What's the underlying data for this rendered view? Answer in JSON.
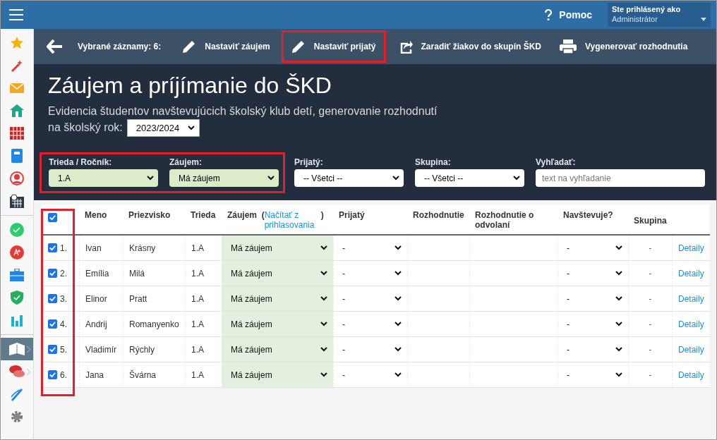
{
  "top_bar": {
    "help": "Pomoc",
    "user_label": "Ste prihlásený ako",
    "user_role": "Administrátor"
  },
  "sidebar": {
    "items": [
      {
        "kind": "star",
        "selected": false,
        "expandable": false
      },
      {
        "kind": "wand",
        "selected": false,
        "expandable": false
      },
      {
        "kind": "mail",
        "selected": false,
        "expandable": false
      },
      {
        "kind": "home",
        "selected": false,
        "expandable": false
      },
      {
        "kind": "calendar",
        "selected": false,
        "expandable": false
      },
      {
        "kind": "notebook",
        "selected": false,
        "expandable": false
      },
      {
        "kind": "person",
        "selected": false,
        "expandable": false
      },
      {
        "kind": "schedule",
        "selected": false,
        "expandable": false
      },
      {
        "kind": "divider"
      },
      {
        "kind": "check",
        "selected": false,
        "expandable": false
      },
      {
        "kind": "grade",
        "selected": false,
        "expandable": false
      },
      {
        "kind": "briefcase",
        "selected": false,
        "expandable": false
      },
      {
        "kind": "shield",
        "selected": false,
        "expandable": false
      },
      {
        "kind": "chart",
        "selected": false,
        "expandable": false
      },
      {
        "kind": "divider"
      },
      {
        "kind": "book",
        "selected": true,
        "expandable": true
      },
      {
        "kind": "chat",
        "selected": false,
        "expandable": true
      },
      {
        "kind": "pen",
        "selected": false,
        "expandable": false
      },
      {
        "kind": "gear",
        "selected": false,
        "expandable": false
      }
    ]
  },
  "toolbar": {
    "selected_count": "Vybrané záznamy: 6:",
    "actions": [
      {
        "kind": "edit",
        "label": "Nastaviť záujem",
        "highlighted": false
      },
      {
        "kind": "edit",
        "label": "Nastaviť prijatý",
        "highlighted": true
      },
      {
        "kind": "share",
        "label": "Zaradiť žiakov do skupín ŠKD",
        "highlighted": false
      },
      {
        "kind": "print",
        "label": "Vygenerovať rozhodnutia",
        "highlighted": false
      }
    ]
  },
  "page": {
    "title": "Záujem a príjímanie do ŠKD",
    "subtitle": "Evidencia študentov navštevujúcich školský klub detí, generovanie rozhodnutí",
    "year_label": "na školský rok:",
    "year": "2023/2024"
  },
  "filter_groups": [
    {
      "highlighted": true,
      "filters": [
        {
          "kind": "select",
          "label": "Trieda / Ročník:",
          "value": "1.A",
          "active": true
        },
        {
          "kind": "select",
          "label": "Záujem:",
          "value": "Má záujem",
          "active": true
        }
      ]
    },
    {
      "highlighted": false,
      "filters": [
        {
          "kind": "select",
          "label": "Prijatý:",
          "value": "-- Všetci --",
          "active": false
        },
        {
          "kind": "select",
          "label": "Skupina:",
          "value": "-- Všetci --",
          "active": false
        },
        {
          "kind": "search",
          "label": "Vyhľadať:",
          "placeholder": "text na vyhľadanie"
        }
      ]
    }
  ],
  "table": {
    "checkbox_column_highlighted": true,
    "all_checked": true,
    "columns": [
      {
        "label": "Meno"
      },
      {
        "label": "Priezvisko"
      },
      {
        "label": "Trieda"
      },
      {
        "label": "Záujem",
        "link_prefix": "(",
        "link": "Načítať z prihlasovania",
        "link_suffix": ")"
      },
      {
        "label": "Prijatý"
      },
      {
        "label": "Rozhodnutie"
      },
      {
        "label": "Rozhodnutie o odvolaní"
      },
      {
        "label": "Navštevuje?"
      },
      {
        "label": "Skupina"
      }
    ],
    "rows": [
      {
        "checked": true,
        "number": "1.",
        "first_name": "Ivan",
        "last_name": "Krásny",
        "class": "1.A",
        "interest": "Má záujem",
        "accepted": "-",
        "attends": "-",
        "group": "-",
        "detail": "Detaily"
      },
      {
        "checked": true,
        "number": "2.",
        "first_name": "Emília",
        "last_name": "Milá",
        "class": "1.A",
        "interest": "Má záujem",
        "accepted": "-",
        "attends": "-",
        "group": "-",
        "detail": "Detaily"
      },
      {
        "checked": true,
        "number": "3.",
        "first_name": "Elinor",
        "last_name": "Pratt",
        "class": "1.A",
        "interest": "Má záujem",
        "accepted": "-",
        "attends": "-",
        "group": "-",
        "detail": "Detaily"
      },
      {
        "checked": true,
        "number": "4.",
        "first_name": "Andrij",
        "last_name": "Romanyenko",
        "class": "1.A",
        "interest": "Má záujem",
        "accepted": "-",
        "attends": "-",
        "group": "-",
        "detail": "Detaily"
      },
      {
        "checked": true,
        "number": "5.",
        "first_name": "Vladimír",
        "last_name": "Rýchly",
        "class": "1.A",
        "interest": "Má záujem",
        "accepted": "-",
        "attends": "-",
        "group": "-",
        "detail": "Detaily"
      },
      {
        "checked": true,
        "number": "6.",
        "first_name": "Jana",
        "last_name": "Švárna",
        "class": "1.A",
        "interest": "Má záujem",
        "accepted": "-",
        "attends": "-",
        "group": "-",
        "detail": "Detaily"
      }
    ]
  }
}
